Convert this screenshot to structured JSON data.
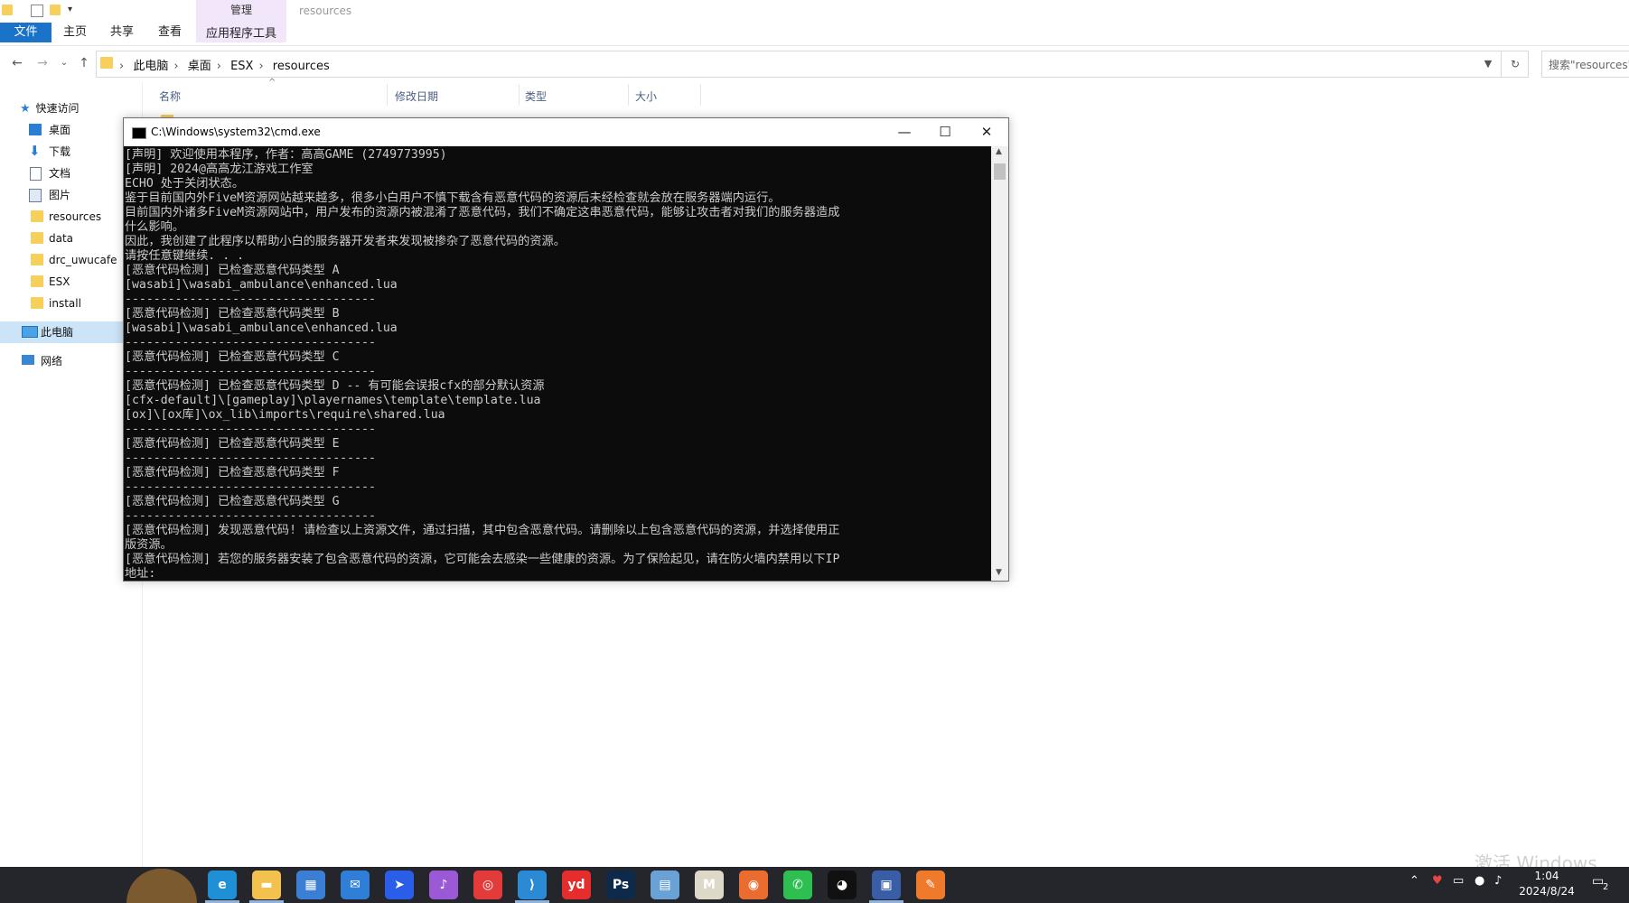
{
  "ribbon": {
    "tabs": [
      "文件",
      "主页",
      "共享",
      "查看"
    ],
    "manage_label": "管理",
    "app_tools_label": "应用程序工具",
    "window_title": "resources"
  },
  "address": {
    "crumbs": [
      "此电脑",
      "桌面",
      "ESX",
      "resources"
    ],
    "search_placeholder": "搜索\"resources\""
  },
  "columns": [
    "名称",
    "修改日期",
    "类型",
    "大小"
  ],
  "sidebar": {
    "quick_access": "快速访问",
    "items": [
      "桌面",
      "下载",
      "文档",
      "图片",
      "resources",
      "data",
      "drc_uwucafe",
      "ESX",
      "install"
    ],
    "this_pc": "此电脑",
    "network": "网络"
  },
  "cmd": {
    "title": "C:\\Windows\\system32\\cmd.exe",
    "lines": [
      "[声明] 欢迎使用本程序，作者：高高GAME (2749773995)",
      "[声明] 2024@高高龙江游戏工作室",
      "ECHO 处于关闭状态。",
      "鉴于目前国内外FiveM资源网站越来越多，很多小白用户不慎下载含有恶意代码的资源后未经检查就会放在服务器端内运行。",
      "目前国内外诸多FiveM资源网站中，用户发布的资源内被混淆了恶意代码，我们不确定这串恶意代码，能够让攻击者对我们的服务器造成",
      "什么影响。",
      "因此，我创建了此程序以帮助小白的服务器开发者来发现被掺杂了恶意代码的资源。",
      "请按任意键继续. . .",
      "[恶意代码检测] 已检查恶意代码类型 A",
      "[wasabi]\\wasabi_ambulance\\enhanced.lua",
      "-----------------------------------",
      "[恶意代码检测] 已检查恶意代码类型 B",
      "[wasabi]\\wasabi_ambulance\\enhanced.lua",
      "-----------------------------------",
      "[恶意代码检测] 已检查恶意代码类型 C",
      "-----------------------------------",
      "[恶意代码检测] 已检查恶意代码类型 D -- 有可能会误报cfx的部分默认资源",
      "[cfx-default]\\[gameplay]\\playernames\\template\\template.lua",
      "[ox]\\[ox库]\\ox_lib\\imports\\require\\shared.lua",
      "-----------------------------------",
      "[恶意代码检测] 已检查恶意代码类型 E",
      "-----------------------------------",
      "[恶意代码检测] 已检查恶意代码类型 F",
      "-----------------------------------",
      "[恶意代码检测] 已检查恶意代码类型 G",
      "-----------------------------------",
      "[恶意代码检测] 发现恶意代码! 请检查以上资源文件，通过扫描，其中包含恶意代码。请删除以上包含恶意代码的资源，并选择使用正",
      "版资源。",
      "[恶意代码检测] 若您的服务器安装了包含恶意代码的资源，它可能会去感染一些健康的资源。为了保险起见，请在防火墙内禁用以下IP",
      "地址:"
    ]
  },
  "taskbar": {
    "time": "1:04",
    "date": "2024/8/24",
    "notification_count": "2",
    "watermark": "激活 Windows",
    "apps": [
      {
        "name": "edge-icon",
        "glyph": "e",
        "color": "#1f8fd6"
      },
      {
        "name": "file-explorer-icon",
        "glyph": "▬",
        "color": "#f2c14e"
      },
      {
        "name": "store-icon",
        "glyph": "▦",
        "color": "#3b7fd4"
      },
      {
        "name": "mail-icon",
        "glyph": "✉",
        "color": "#2f7fd8"
      },
      {
        "name": "feishu-icon",
        "glyph": "➤",
        "color": "#2a5ee8"
      },
      {
        "name": "music-app-icon",
        "glyph": "♪",
        "color": "#9b59d6"
      },
      {
        "name": "netease-music-icon",
        "glyph": "◎",
        "color": "#e33a3a"
      },
      {
        "name": "vscode-icon",
        "glyph": "⟩",
        "color": "#2b8ad6"
      },
      {
        "name": "youdao-icon",
        "glyph": "yd",
        "color": "#e52d2d"
      },
      {
        "name": "photoshop-icon",
        "glyph": "Ps",
        "color": "#0d2a4a"
      },
      {
        "name": "archive-icon",
        "glyph": "▤",
        "color": "#6aa2d6"
      },
      {
        "name": "notes-app-icon",
        "glyph": "M",
        "color": "#ddd8c8"
      },
      {
        "name": "game-app-icon",
        "glyph": "◉",
        "color": "#ea6d2f"
      },
      {
        "name": "wechat-icon",
        "glyph": "✆",
        "color": "#2dbf4f"
      },
      {
        "name": "qq-icon",
        "glyph": "◕",
        "color": "#111111"
      },
      {
        "name": "cmd-task-icon",
        "glyph": "▣",
        "color": "#3a5da8"
      },
      {
        "name": "app-icon",
        "glyph": "✎",
        "color": "#f07a2c"
      }
    ]
  }
}
